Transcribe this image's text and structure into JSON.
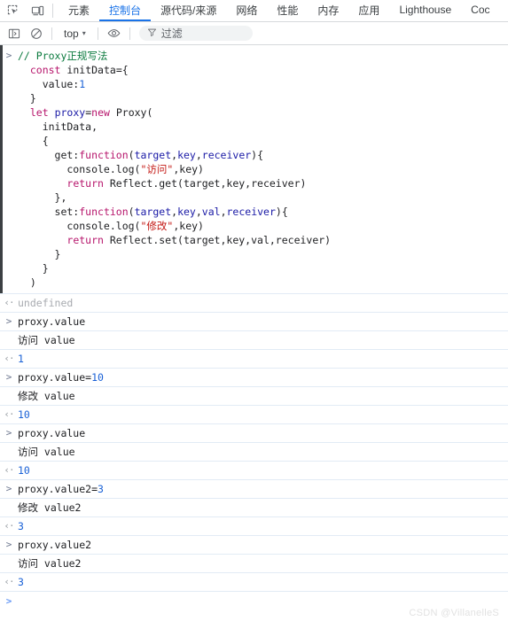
{
  "tabstrip": {
    "icons": [
      {
        "name": "inspect-element-icon",
        "label": "Inspect element"
      },
      {
        "name": "device-toolbar-icon",
        "label": "Toggle device toolbar"
      }
    ],
    "tabs": [
      {
        "label": "元素",
        "active": false
      },
      {
        "label": "控制台",
        "active": true
      },
      {
        "label": "源代码/来源",
        "active": false
      },
      {
        "label": "网络",
        "active": false
      },
      {
        "label": "性能",
        "active": false
      },
      {
        "label": "内存",
        "active": false
      },
      {
        "label": "应用",
        "active": false
      },
      {
        "label": "Lighthouse",
        "active": false
      },
      {
        "label": "Coc",
        "active": false
      }
    ]
  },
  "console_toolbar": {
    "sidebar_toggle": "sidebar-toggle-icon",
    "clear_console": "clear-console-icon",
    "context": "top",
    "context_caret": "▾",
    "eye_icon": "eye-icon",
    "filter_icon": "filter-funnel-icon",
    "filter_placeholder": "过滤"
  },
  "code_block": {
    "marker": ">",
    "lines": [
      [
        {
          "t": "// Proxy正规写法",
          "c": "tok-comment"
        }
      ],
      [
        {
          "t": "  ",
          "c": "tok-plain"
        },
        {
          "t": "const",
          "c": "tok-kw"
        },
        {
          "t": " ",
          "c": "tok-plain"
        },
        {
          "t": "initData",
          "c": "tok-plain"
        },
        {
          "t": "={",
          "c": "tok-plain"
        }
      ],
      [
        {
          "t": "    value:",
          "c": "tok-plain"
        },
        {
          "t": "1",
          "c": "tok-num"
        }
      ],
      [
        {
          "t": "  }",
          "c": "tok-plain"
        }
      ],
      [
        {
          "t": "  ",
          "c": "tok-plain"
        },
        {
          "t": "let",
          "c": "tok-kw"
        },
        {
          "t": " ",
          "c": "tok-plain"
        },
        {
          "t": "proxy",
          "c": "tok-var"
        },
        {
          "t": "=",
          "c": "tok-plain"
        },
        {
          "t": "new",
          "c": "tok-kw"
        },
        {
          "t": " Proxy(",
          "c": "tok-plain"
        }
      ],
      [
        {
          "t": "    initData,",
          "c": "tok-plain"
        }
      ],
      [
        {
          "t": "    {",
          "c": "tok-plain"
        }
      ],
      [
        {
          "t": "      get:",
          "c": "tok-plain"
        },
        {
          "t": "function",
          "c": "tok-kw"
        },
        {
          "t": "(",
          "c": "tok-plain"
        },
        {
          "t": "target",
          "c": "tok-var"
        },
        {
          "t": ",",
          "c": "tok-plain"
        },
        {
          "t": "key",
          "c": "tok-var"
        },
        {
          "t": ",",
          "c": "tok-plain"
        },
        {
          "t": "receiver",
          "c": "tok-var"
        },
        {
          "t": "){",
          "c": "tok-plain"
        }
      ],
      [
        {
          "t": "        console.log(",
          "c": "tok-plain"
        },
        {
          "t": "\"访问\"",
          "c": "tok-str"
        },
        {
          "t": ",key)",
          "c": "tok-plain"
        }
      ],
      [
        {
          "t": "        ",
          "c": "tok-plain"
        },
        {
          "t": "return",
          "c": "tok-kw"
        },
        {
          "t": " Reflect.get(target,key,receiver)",
          "c": "tok-plain"
        }
      ],
      [
        {
          "t": "      },",
          "c": "tok-plain"
        }
      ],
      [
        {
          "t": "      set:",
          "c": "tok-plain"
        },
        {
          "t": "function",
          "c": "tok-kw"
        },
        {
          "t": "(",
          "c": "tok-plain"
        },
        {
          "t": "target",
          "c": "tok-var"
        },
        {
          "t": ",",
          "c": "tok-plain"
        },
        {
          "t": "key",
          "c": "tok-var"
        },
        {
          "t": ",",
          "c": "tok-plain"
        },
        {
          "t": "val",
          "c": "tok-var"
        },
        {
          "t": ",",
          "c": "tok-plain"
        },
        {
          "t": "receiver",
          "c": "tok-var"
        },
        {
          "t": "){",
          "c": "tok-plain"
        }
      ],
      [
        {
          "t": "        console.log(",
          "c": "tok-plain"
        },
        {
          "t": "\"修改\"",
          "c": "tok-str"
        },
        {
          "t": ",key)",
          "c": "tok-plain"
        }
      ],
      [
        {
          "t": "        ",
          "c": "tok-plain"
        },
        {
          "t": "return",
          "c": "tok-kw"
        },
        {
          "t": " Reflect.set(target,key,val,receiver)",
          "c": "tok-plain"
        }
      ],
      [
        {
          "t": "      }",
          "c": "tok-plain"
        }
      ],
      [
        {
          "t": "    }",
          "c": "tok-plain"
        }
      ],
      [
        {
          "t": "  )",
          "c": "tok-plain"
        }
      ]
    ]
  },
  "messages": [
    {
      "kind": "output",
      "marker": "‹·",
      "parts": [
        {
          "t": "undefined",
          "c": "tok-undef"
        }
      ]
    },
    {
      "kind": "input",
      "marker": ">",
      "parts": [
        {
          "t": "proxy.value",
          "c": "tok-plain"
        }
      ]
    },
    {
      "kind": "log",
      "marker": "",
      "parts": [
        {
          "t": "访问 value",
          "c": "log-text"
        }
      ]
    },
    {
      "kind": "output",
      "marker": "‹·",
      "parts": [
        {
          "t": "1",
          "c": "val-num"
        }
      ]
    },
    {
      "kind": "input",
      "marker": ">",
      "parts": [
        {
          "t": "proxy.value=",
          "c": "tok-plain"
        },
        {
          "t": "10",
          "c": "val-num"
        }
      ]
    },
    {
      "kind": "log",
      "marker": "",
      "parts": [
        {
          "t": "修改 value",
          "c": "log-text"
        }
      ]
    },
    {
      "kind": "output",
      "marker": "‹·",
      "parts": [
        {
          "t": "10",
          "c": "val-num"
        }
      ]
    },
    {
      "kind": "input",
      "marker": ">",
      "parts": [
        {
          "t": "proxy.value",
          "c": "tok-plain"
        }
      ]
    },
    {
      "kind": "log",
      "marker": "",
      "parts": [
        {
          "t": "访问 value",
          "c": "log-text"
        }
      ]
    },
    {
      "kind": "output",
      "marker": "‹·",
      "parts": [
        {
          "t": "10",
          "c": "val-num"
        }
      ]
    },
    {
      "kind": "input",
      "marker": ">",
      "parts": [
        {
          "t": "proxy.value2=",
          "c": "tok-plain"
        },
        {
          "t": "3",
          "c": "val-num"
        }
      ]
    },
    {
      "kind": "log",
      "marker": "",
      "parts": [
        {
          "t": "修改 value2",
          "c": "log-text"
        }
      ]
    },
    {
      "kind": "output",
      "marker": "‹·",
      "parts": [
        {
          "t": "3",
          "c": "val-num"
        }
      ]
    },
    {
      "kind": "input",
      "marker": ">",
      "parts": [
        {
          "t": "proxy.value2",
          "c": "tok-plain"
        }
      ]
    },
    {
      "kind": "log",
      "marker": "",
      "parts": [
        {
          "t": "访问 value2",
          "c": "log-text"
        }
      ]
    },
    {
      "kind": "output",
      "marker": "‹·",
      "parts": [
        {
          "t": "3",
          "c": "val-num"
        }
      ]
    }
  ],
  "prompt": {
    "marker": ">",
    "value": ""
  },
  "watermark": "CSDN @VillanelleS",
  "colors": {
    "accent": "#1a73e8",
    "separator": "#e2ebf5",
    "toolbar_border": "#d6d9dc",
    "string": "#c41a16",
    "keyword": "#b7166c",
    "comment": "#0b7a3e",
    "number": "#1a61d6"
  }
}
